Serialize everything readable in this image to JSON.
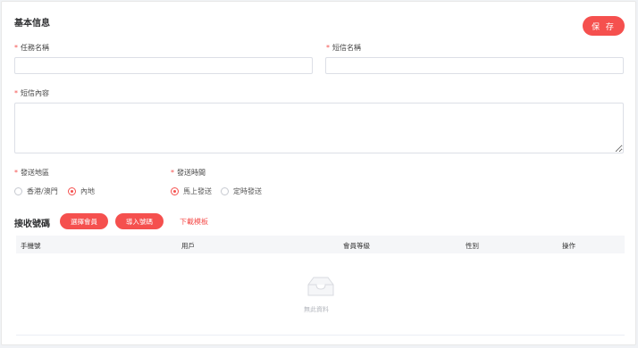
{
  "basic_info": {
    "title": "基本信息",
    "save_label": "保 存",
    "task_name_label": "任務名稱",
    "sms_name_label": "短信名稱",
    "sms_content_label": "短信內容",
    "task_name_value": "",
    "sms_name_value": "",
    "sms_content_value": "",
    "region_label": "發送地區",
    "region_options": [
      "香港/澳門",
      "內地"
    ],
    "region_selected": "內地",
    "time_label": "發送時間",
    "time_options": [
      "馬上發送",
      "定時發送"
    ],
    "time_selected": "馬上發送"
  },
  "recipients": {
    "title": "接收號碼",
    "select_members_label": "選擇會員",
    "import_numbers_label": "導入號碼",
    "download_template_label": "下載模板",
    "columns": [
      "手機號",
      "用戶",
      "會員等級",
      "性別",
      "操作"
    ],
    "empty_text": "無此資料",
    "empty_icon": "inbox-icon"
  },
  "colors": {
    "accent": "#f5504e",
    "border": "#dcdfe6",
    "header_bg": "#f5f6f8"
  }
}
